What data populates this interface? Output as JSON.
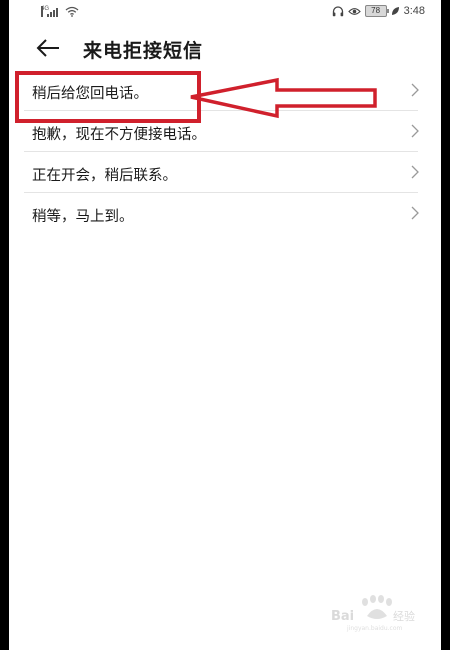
{
  "status_bar": {
    "network_label": "4G",
    "battery_level": "78",
    "time": "3:48",
    "icons": [
      "signal-icon",
      "wifi-icon",
      "headphone-icon",
      "eye-comfort-icon",
      "battery-icon",
      "leaf-icon"
    ]
  },
  "header": {
    "back_icon": "arrow-left-icon",
    "title": "来电拒接短信"
  },
  "messages": [
    {
      "label": "稍后给您回电话。"
    },
    {
      "label": "抱歉，现在不方便接电话。"
    },
    {
      "label": "正在开会，稍后联系。"
    },
    {
      "label": "稍等，马上到。"
    }
  ],
  "annotation": {
    "color": "#d0202c",
    "target": "稍后给您回电话。"
  },
  "watermark": {
    "text": "Baidu经验",
    "sub": "jingyan.baidu.com"
  }
}
